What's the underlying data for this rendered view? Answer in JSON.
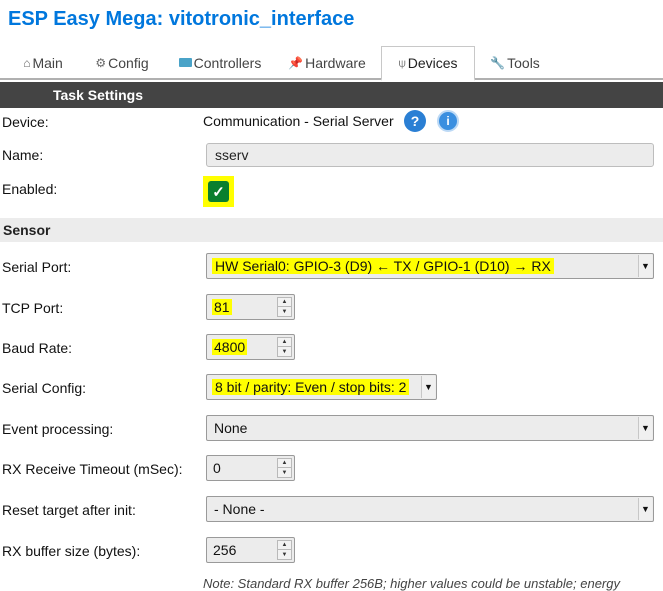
{
  "app": {
    "title": "ESP Easy Mega: vitotronic_interface"
  },
  "tabs": [
    {
      "label": "Main",
      "icon": "home-icon",
      "glyph": "⌂"
    },
    {
      "label": "Config",
      "icon": "gear-icon",
      "glyph": "⚙"
    },
    {
      "label": "Controllers",
      "icon": "chat-icon",
      "glyph": ""
    },
    {
      "label": "Hardware",
      "icon": "pin-icon",
      "glyph": "📌"
    },
    {
      "label": "Devices",
      "icon": "plug-icon",
      "glyph": "⍦"
    },
    {
      "label": "Tools",
      "icon": "wrench-icon",
      "glyph": "🔧"
    }
  ],
  "active_tab": "Devices",
  "task_settings": {
    "header": "Task Settings",
    "device_label": "Device:",
    "device_value": "Communication - Serial Server",
    "help_icons": {
      "question": "?",
      "info": "i"
    },
    "name_label": "Name:",
    "name_value": "sserv",
    "enabled_label": "Enabled:",
    "enabled": true,
    "check_glyph": "✓"
  },
  "sensor": {
    "header": "Sensor",
    "serial_port_label": "Serial Port:",
    "serial_port_value": "HW Serial0: GPIO-3 (D9) ← TX / GPIO-1 (D10) → RX",
    "tcp_port_label": "TCP Port:",
    "tcp_port_value": "81",
    "baud_rate_label": "Baud Rate:",
    "baud_rate_value": "4800",
    "serial_config_label": "Serial Config:",
    "serial_config_value": "8 bit / parity: Even / stop bits: 2",
    "event_processing_label": "Event processing:",
    "event_processing_value": "None",
    "rx_timeout_label": "RX Receive Timeout (mSec):",
    "rx_timeout_value": "0",
    "reset_target_label": "Reset target after init:",
    "reset_target_value": "- None -",
    "rx_buffer_label": "RX buffer size (bytes):",
    "rx_buffer_value": "256",
    "note": "Note: Standard RX buffer 256B; higher values could be unstable; energy"
  },
  "colors": {
    "title_blue": "#0077dd",
    "section_dark": "#444444",
    "highlight": "#ffff00",
    "check_green": "#0a7f2e",
    "help_blue": "#2a7fd4"
  }
}
